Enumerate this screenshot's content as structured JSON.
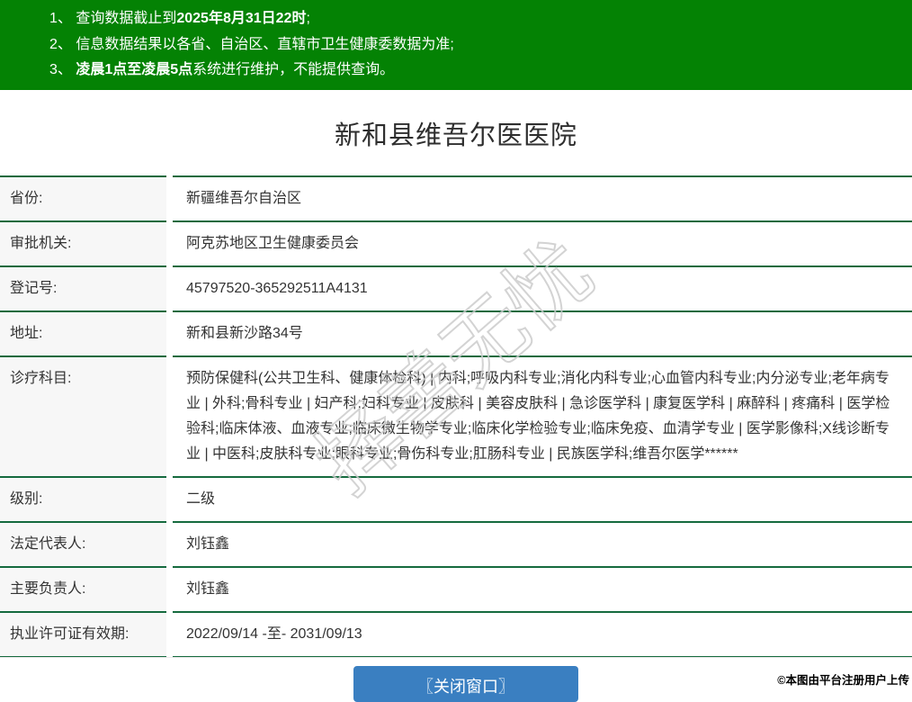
{
  "header": {
    "bg_color": "#048204",
    "notices": [
      {
        "prefix": "1、 查询数据截止到",
        "bold": "2025年8月31日22时",
        "suffix": ";"
      },
      {
        "prefix": "2、 信息数据结果以各省、自治区、直辖市卫生健康委数据为准;",
        "bold": "",
        "suffix": ""
      },
      {
        "prefix": "3、 ",
        "bold": "凌晨1点至凌晨5点",
        "suffix": "系统进行维护，不能提供查询。"
      }
    ]
  },
  "title": "新和县维吾尔医医院",
  "table": {
    "border_color": "#156a3e",
    "label_bg_color": "#f7f7f7",
    "rows": [
      {
        "label": "省份:",
        "value": "新疆维吾尔自治区"
      },
      {
        "label": "审批机关:",
        "value": "阿克苏地区卫生健康委员会"
      },
      {
        "label": "登记号:",
        "value": "45797520-365292511A4131"
      },
      {
        "label": "地址:",
        "value": "新和县新沙路34号"
      },
      {
        "label": "诊疗科目:",
        "value": "预防保健科(公共卫生科、健康体检科) | 内科;呼吸内科专业;消化内科专业;心血管内科专业;内分泌专业;老年病专业 | 外科;骨科专业 | 妇产科;妇科专业 | 皮肤科 | 美容皮肤科 | 急诊医学科 | 康复医学科 | 麻醉科 | 疼痛科 | 医学检验科;临床体液、血液专业;临床微生物学专业;临床化学检验专业;临床免疫、血清学专业 | 医学影像科;X线诊断专业 | 中医科;皮肤科专业;眼科专业;骨伤科专业;肛肠科专业 | 民族医学科;维吾尔医学******"
      },
      {
        "label": "级别:",
        "value": "二级"
      },
      {
        "label": "法定代表人:",
        "value": "刘钰鑫"
      },
      {
        "label": "主要负责人:",
        "value": "刘钰鑫"
      },
      {
        "label": "执业许可证有效期:",
        "value": "2022/09/14 -至- 2031/09/13"
      }
    ]
  },
  "footer": {
    "close_button_label": "〖关闭窗口〗",
    "button_color": "#3a7fc1",
    "credit": "©本图由平台注册用户上传"
  },
  "watermark_text": "择善无忧"
}
